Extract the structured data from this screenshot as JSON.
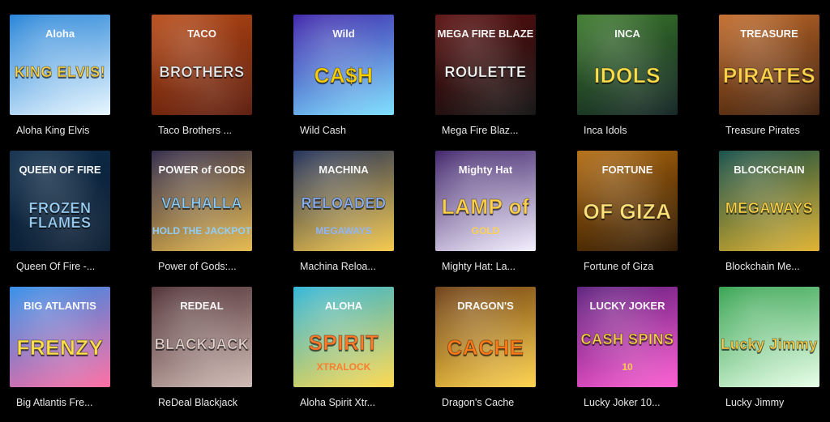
{
  "games": [
    {
      "title": "Aloha King Elvis",
      "art": [
        "Aloha",
        "KING ELVIS!"
      ],
      "colors": [
        "#1e7fd6",
        "#ffd54a",
        "#e8f7ff"
      ]
    },
    {
      "title": "Taco Brothers ...",
      "art": [
        "TACO",
        "BROTHERS"
      ],
      "colors": [
        "#b84a16",
        "#f2f2f2",
        "#5a1a0a"
      ]
    },
    {
      "title": "Wild Cash",
      "art": [
        "Wild",
        "CA$H"
      ],
      "colors": [
        "#3a1fa8",
        "#ffd000",
        "#7ae0ff"
      ]
    },
    {
      "title": "Mega Fire Blaz...",
      "art": [
        "MEGA FIRE BLAZE",
        "ROULETTE"
      ],
      "colors": [
        "#5a0d0d",
        "#ffffff",
        "#111111"
      ]
    },
    {
      "title": "Inca Idols",
      "art": [
        "INCA",
        "IDOLS"
      ],
      "colors": [
        "#3b7a2a",
        "#ffe04a",
        "#122"
      ]
    },
    {
      "title": "Treasure Pirates",
      "art": [
        "TREASURE",
        "PIRATES"
      ],
      "colors": [
        "#c36b2a",
        "#ffd34a",
        "#3a1d0b"
      ]
    },
    {
      "title": "Queen Of Fire -...",
      "art": [
        "QUEEN OF FIRE",
        "FROZEN FLAMES"
      ],
      "colors": [
        "#0d2c4a",
        "#9fd6ff",
        "#0a1c30"
      ]
    },
    {
      "title": "Power of Gods:...",
      "art": [
        "POWER of GODS",
        "VALHALLA",
        "HOLD THE JACKPOT"
      ],
      "colors": [
        "#2b2445",
        "#8fd0ff",
        "#e6b94a"
      ]
    },
    {
      "title": "Machina Reloa...",
      "art": [
        "MACHINA",
        "RELOADED",
        "MEGAWAYS"
      ],
      "colors": [
        "#1a2a55",
        "#8fb6ff",
        "#f7c948"
      ]
    },
    {
      "title": "Mighty Hat: La...",
      "art": [
        "Mighty Hat",
        "LAMP of",
        "GOLD"
      ],
      "colors": [
        "#3a1d66",
        "#ffd24a",
        "#f4f0ff"
      ]
    },
    {
      "title": "Fortune of Giza",
      "art": [
        "FORTUNE",
        "OF GIZA"
      ],
      "colors": [
        "#b26b10",
        "#ffe27a",
        "#2a1500"
      ]
    },
    {
      "title": "Blockchain Me...",
      "art": [
        "BLOCKCHAIN",
        "MEGAWAYS"
      ],
      "colors": [
        "#0f4a44",
        "#ffd84a",
        "#e0b12c"
      ]
    },
    {
      "title": "Big Atlantis Fre...",
      "art": [
        "BIG ATLANTIS",
        "FRENZY"
      ],
      "colors": [
        "#2d8be8",
        "#ffe04a",
        "#ff6aa0"
      ]
    },
    {
      "title": "ReDeal Blackjack",
      "art": [
        "REDEAL",
        "BLACKJACK"
      ],
      "colors": [
        "#4a2a2f",
        "#e9d7cf",
        "#cfbab3"
      ]
    },
    {
      "title": "Aloha Spirit Xtr...",
      "art": [
        "ALOHA",
        "SPIRIT",
        "XTRALOCK"
      ],
      "colors": [
        "#2bb3d6",
        "#ff7a2a",
        "#ffd84a"
      ]
    },
    {
      "title": "Dragon's Cache",
      "art": [
        "DRAGON'S",
        "CACHE"
      ],
      "colors": [
        "#6a3a10",
        "#ff7a1a",
        "#ffd34a"
      ]
    },
    {
      "title": "Lucky Joker 10...",
      "art": [
        "LUCKY JOKER",
        "CASH SPINS",
        "10"
      ],
      "colors": [
        "#5a1b7a",
        "#ffd34a",
        "#ff5ad1"
      ]
    },
    {
      "title": "Lucky Jimmy",
      "art": [
        "Lucky Jimmy"
      ],
      "colors": [
        "#2fa04a",
        "#ffd34a",
        "#e8ffe8"
      ]
    }
  ]
}
